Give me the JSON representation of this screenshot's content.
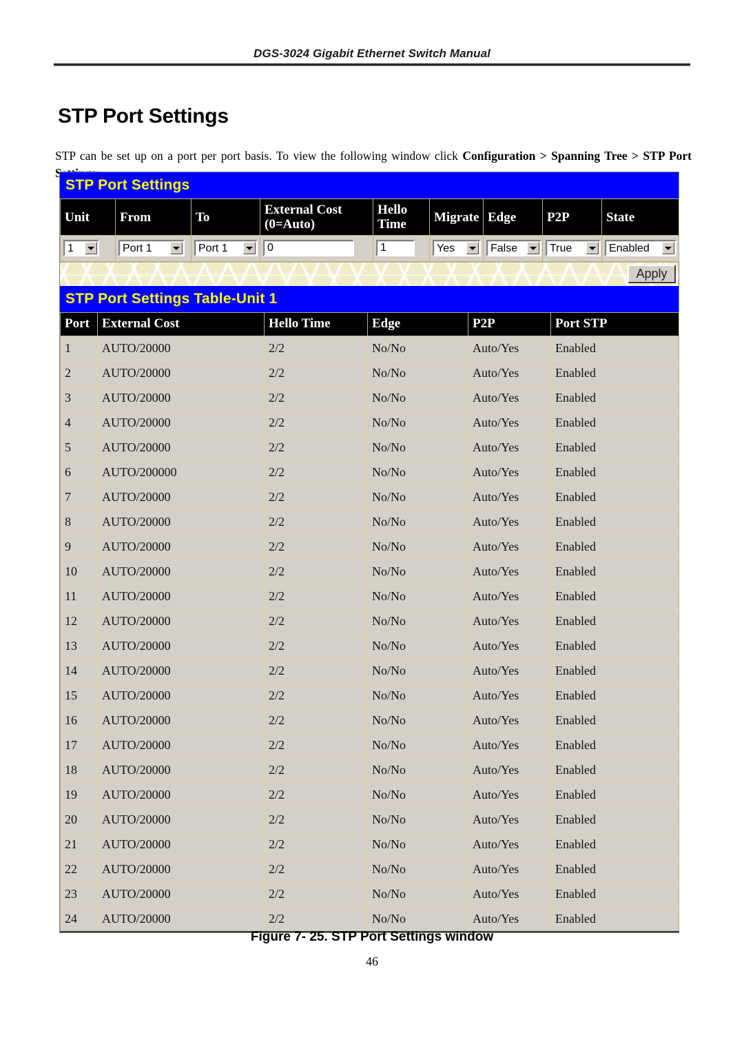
{
  "page": {
    "running_header": "DGS-3024 Gigabit Ethernet Switch Manual",
    "section_title": "STP Port Settings",
    "intro_part1": "STP can be set up on a port per port basis. To view the following window click ",
    "intro_bold": "Configuration > Spanning Tree > STP Port Settings",
    "intro_part2": ":",
    "figure_caption": "Figure 7- 25.  STP Port Settings window",
    "page_number": "46"
  },
  "colors": {
    "titlebar_bg": "#0000FF",
    "titlebar_text": "#FFFF00",
    "header_row_bg": "#000000",
    "header_row_text": "#FFFFFF",
    "row_bg": "#D4D0C8",
    "strip_bg": "#F0ECC8"
  },
  "config_panel": {
    "title": "STP Port Settings",
    "headers": [
      "Unit",
      "From",
      "To",
      "External Cost (0=Auto)",
      "Hello Time",
      "Migrate",
      "Edge",
      "P2P",
      "State"
    ],
    "header_lines": {
      "external_cost_l1": "External Cost",
      "external_cost_l2": "(0=Auto)",
      "hello_l1": "Hello",
      "hello_l2": "Time"
    },
    "fields": {
      "unit": {
        "type": "select",
        "value": "1"
      },
      "from": {
        "type": "select",
        "value": "Port 1"
      },
      "to": {
        "type": "select",
        "value": "Port 1"
      },
      "external_cost": {
        "type": "text",
        "value": "0"
      },
      "hello_time": {
        "type": "text",
        "value": "1"
      },
      "migrate": {
        "type": "select",
        "value": "Yes"
      },
      "edge": {
        "type": "select",
        "value": "False"
      },
      "p2p": {
        "type": "select",
        "value": "True"
      },
      "state": {
        "type": "select",
        "value": "Enabled"
      }
    },
    "apply_label": "Apply"
  },
  "results_table": {
    "title": "STP Port Settings Table-Unit 1",
    "headers": [
      "Port",
      "External Cost",
      "Hello Time",
      "Edge",
      "P2P",
      "Port STP"
    ],
    "rows": [
      [
        "1",
        "AUTO/20000",
        "2/2",
        "No/No",
        "Auto/Yes",
        "Enabled"
      ],
      [
        "2",
        "AUTO/20000",
        "2/2",
        "No/No",
        "Auto/Yes",
        "Enabled"
      ],
      [
        "3",
        "AUTO/20000",
        "2/2",
        "No/No",
        "Auto/Yes",
        "Enabled"
      ],
      [
        "4",
        "AUTO/20000",
        "2/2",
        "No/No",
        "Auto/Yes",
        "Enabled"
      ],
      [
        "5",
        "AUTO/20000",
        "2/2",
        "No/No",
        "Auto/Yes",
        "Enabled"
      ],
      [
        "6",
        "AUTO/200000",
        "2/2",
        "No/No",
        "Auto/Yes",
        "Enabled"
      ],
      [
        "7",
        "AUTO/20000",
        "2/2",
        "No/No",
        "Auto/Yes",
        "Enabled"
      ],
      [
        "8",
        "AUTO/20000",
        "2/2",
        "No/No",
        "Auto/Yes",
        "Enabled"
      ],
      [
        "9",
        "AUTO/20000",
        "2/2",
        "No/No",
        "Auto/Yes",
        "Enabled"
      ],
      [
        "10",
        "AUTO/20000",
        "2/2",
        "No/No",
        "Auto/Yes",
        "Enabled"
      ],
      [
        "11",
        "AUTO/20000",
        "2/2",
        "No/No",
        "Auto/Yes",
        "Enabled"
      ],
      [
        "12",
        "AUTO/20000",
        "2/2",
        "No/No",
        "Auto/Yes",
        "Enabled"
      ],
      [
        "13",
        "AUTO/20000",
        "2/2",
        "No/No",
        "Auto/Yes",
        "Enabled"
      ],
      [
        "14",
        "AUTO/20000",
        "2/2",
        "No/No",
        "Auto/Yes",
        "Enabled"
      ],
      [
        "15",
        "AUTO/20000",
        "2/2",
        "No/No",
        "Auto/Yes",
        "Enabled"
      ],
      [
        "16",
        "AUTO/20000",
        "2/2",
        "No/No",
        "Auto/Yes",
        "Enabled"
      ],
      [
        "17",
        "AUTO/20000",
        "2/2",
        "No/No",
        "Auto/Yes",
        "Enabled"
      ],
      [
        "18",
        "AUTO/20000",
        "2/2",
        "No/No",
        "Auto/Yes",
        "Enabled"
      ],
      [
        "19",
        "AUTO/20000",
        "2/2",
        "No/No",
        "Auto/Yes",
        "Enabled"
      ],
      [
        "20",
        "AUTO/20000",
        "2/2",
        "No/No",
        "Auto/Yes",
        "Enabled"
      ],
      [
        "21",
        "AUTO/20000",
        "2/2",
        "No/No",
        "Auto/Yes",
        "Enabled"
      ],
      [
        "22",
        "AUTO/20000",
        "2/2",
        "No/No",
        "Auto/Yes",
        "Enabled"
      ],
      [
        "23",
        "AUTO/20000",
        "2/2",
        "No/No",
        "Auto/Yes",
        "Enabled"
      ],
      [
        "24",
        "AUTO/20000",
        "2/2",
        "No/No",
        "Auto/Yes",
        "Enabled"
      ]
    ]
  }
}
